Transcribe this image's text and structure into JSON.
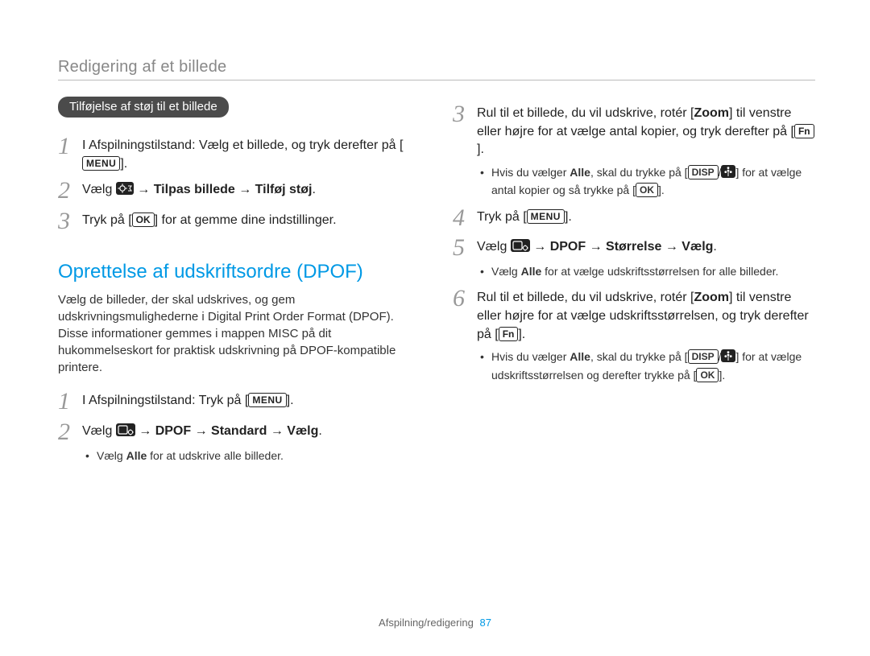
{
  "header": "Redigering af et billede",
  "left": {
    "pill": "Tilføjelse af støj til et billede",
    "steps": [
      {
        "num": "1",
        "pre": "I Afspilningstilstand: Vælg et billede, og tryk derefter på [",
        "key": "MENU",
        "post": "]."
      },
      {
        "num": "2",
        "pre": "Vælg ",
        "icon": "edit-gear",
        "mid": " → ",
        "bold1": "Tilpas billede",
        "mid2": " → ",
        "bold2": "Tilføj støj",
        "post": "."
      },
      {
        "num": "3",
        "pre": "Tryk på [",
        "key": "OK",
        "post": "] for at gemme dine indstillinger."
      }
    ],
    "sectionHeading": "Oprettelse af udskriftsordre (DPOF)",
    "para": "Vælg de billeder, der skal udskrives, og gem udskrivningsmulighederne i Digital Print Order Format (DPOF). Disse informationer gemmes i mappen MISC på dit hukommelseskort for praktisk udskrivning på DPOF-kompatible printere.",
    "steps2": [
      {
        "num": "1",
        "pre": "I Afspilningstilstand: Tryk på [",
        "key": "MENU",
        "post": "]."
      },
      {
        "num": "2",
        "pre": "Vælg ",
        "icon": "card-gear",
        "mid": " → ",
        "bold1": "DPOF",
        "mid2": " → ",
        "bold2": "Standard",
        "mid3": " → ",
        "bold3": "Vælg",
        "post": "."
      }
    ],
    "bullet2": {
      "pre": "Vælg ",
      "bold": "Alle",
      "post": " for at udskrive alle billeder."
    }
  },
  "right": {
    "steps": [
      {
        "num": "3",
        "line1_pre": "Rul til et billede, du vil udskrive, rotér [",
        "line1_bold": "Zoom",
        "line1_post": "] til venstre eller højre for at vælge antal kopier, og tryk derefter på [",
        "line1_key": "Fn",
        "line1_end": "].",
        "bullet": {
          "pre": "Hvis du vælger ",
          "bold": "Alle",
          "mid": ", skal du trykke på [",
          "key1": "DISP",
          "slash": "/",
          "icon": "flower",
          "mid2": "] for at vælge antal kopier og så trykke på [",
          "key2": "OK",
          "post": "]."
        }
      },
      {
        "num": "4",
        "pre": "Tryk på [",
        "key": "MENU",
        "post": "]."
      },
      {
        "num": "5",
        "pre": "Vælg ",
        "icon": "card-gear",
        "mid": " → ",
        "bold1": "DPOF",
        "mid2": " → ",
        "bold2": "Størrelse",
        "mid3": " → ",
        "bold3": "Vælg",
        "post": ".",
        "bullet": {
          "pre": "Vælg ",
          "bold": "Alle",
          "post": " for at vælge udskriftsstørrelsen for alle billeder."
        }
      },
      {
        "num": "6",
        "line1_pre": "Rul til et billede, du vil udskrive, rotér [",
        "line1_bold": "Zoom",
        "line1_post": "] til venstre eller højre for at vælge udskriftsstørrelsen, og tryk derefter på [",
        "line1_key": "Fn",
        "line1_end": "].",
        "bullet": {
          "pre": "Hvis du vælger ",
          "bold": "Alle",
          "mid": ", skal du trykke på [",
          "key1": "DISP",
          "slash": "/",
          "icon": "flower",
          "mid2": "] for at vælge udskriftsstørrelsen og derefter trykke på [",
          "key2": "OK",
          "post": "]."
        }
      }
    ]
  },
  "footer": {
    "text": "Afspilning/redigering",
    "page": "87"
  }
}
